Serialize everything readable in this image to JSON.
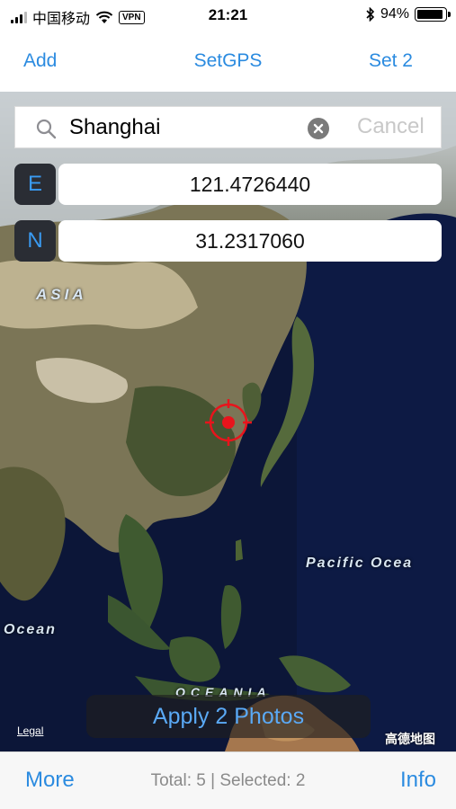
{
  "status_bar": {
    "carrier": "中国移动",
    "vpn": "VPN",
    "time": "21:21",
    "battery_percent": "94%",
    "battery_level": 0.94
  },
  "nav": {
    "left": "Add",
    "title": "SetGPS",
    "right": "Set 2"
  },
  "search": {
    "value": "Shanghai",
    "cancel": "Cancel"
  },
  "coords": {
    "e_tag": "E",
    "e_value": "121.4726440",
    "n_tag": "N",
    "n_value": "31.2317060"
  },
  "map": {
    "labels": {
      "asia": "ASIA",
      "pacific": "Pacific Ocea",
      "ocean": "Ocean",
      "oceania": "OCEANIA"
    },
    "legal": "Legal",
    "attribution": "高德地图",
    "marker_color": "#e8141c"
  },
  "apply_button": "Apply 2 Photos",
  "toolbar": {
    "more": "More",
    "status": "Total: 5 | Selected: 2",
    "info": "Info"
  },
  "colors": {
    "accent": "#2b8be0",
    "map_ocean": "#0c1638"
  }
}
